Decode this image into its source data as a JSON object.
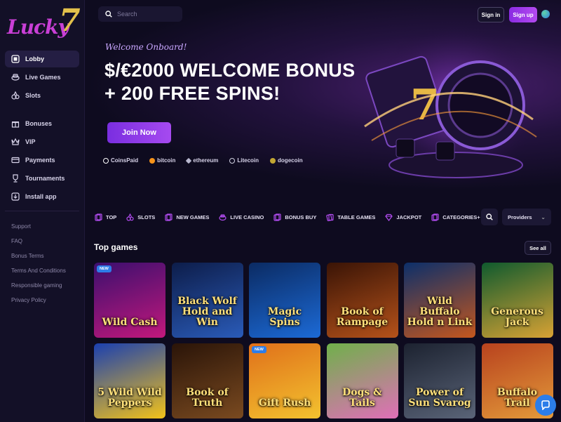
{
  "brand": {
    "logo_text": "Lucky",
    "logo_number": "7"
  },
  "sidebar": {
    "nav": [
      {
        "label": "Lobby",
        "icon": "lobby-icon",
        "active": true
      },
      {
        "label": "Live Games",
        "icon": "live-games-icon"
      },
      {
        "label": "Slots",
        "icon": "slots-icon"
      }
    ],
    "nav2": [
      {
        "label": "Bonuses",
        "icon": "gift-icon"
      },
      {
        "label": "VIP",
        "icon": "crown-icon"
      },
      {
        "label": "Payments",
        "icon": "card-icon"
      },
      {
        "label": "Tournaments",
        "icon": "trophy-icon"
      },
      {
        "label": "Install app",
        "icon": "download-icon"
      }
    ],
    "links": [
      "Support",
      "FAQ",
      "Bonus Terms",
      "Terms And Conditions",
      "Responsible gaming",
      "Privacy Policy"
    ]
  },
  "header": {
    "search_placeholder": "Search",
    "signin_label": "Sign in",
    "signup_label": "Sign up"
  },
  "hero": {
    "welcome": "Welcome Onboard!",
    "title_line1": "$/€2000 WELCOME BONUS",
    "title_line2": "+ 200 FREE SPINS!",
    "cta": "Join Now",
    "payments": [
      {
        "label": "CoinsPaid",
        "color": "#ffffff"
      },
      {
        "label": "bitcoin",
        "color": "#f7931a"
      },
      {
        "label": "ethereum",
        "color": "#b9b9d0"
      },
      {
        "label": "Litecoin",
        "color": "#d0d0e0"
      },
      {
        "label": "dogecoin",
        "color": "#c2a633"
      }
    ]
  },
  "categories": [
    {
      "label": "TOP"
    },
    {
      "label": "SLOTS"
    },
    {
      "label": "NEW GAMES"
    },
    {
      "label": "LIVE CASINO"
    },
    {
      "label": "BONUS BUY"
    },
    {
      "label": "TABLE GAMES"
    },
    {
      "label": "JACKPOT"
    },
    {
      "label": "CATEGORIES+"
    }
  ],
  "providers_label": "Providers",
  "games_section": {
    "title": "Top games",
    "see_all": "See all",
    "new_badge": "NEW",
    "games": [
      {
        "name": "Wild Cash",
        "colors": [
          "#3b0f6e",
          "#c2187c"
        ],
        "new": true
      },
      {
        "name": "Black Wolf Hold and Win",
        "colors": [
          "#0d1d4a",
          "#2a5bb8"
        ],
        "new": false
      },
      {
        "name": "Magic Spins",
        "colors": [
          "#0b2b63",
          "#1c6ad6"
        ],
        "new": false
      },
      {
        "name": "Book of Rampage",
        "colors": [
          "#3a1406",
          "#b5521a"
        ],
        "new": false
      },
      {
        "name": "Wild Buffalo Hold n Link",
        "colors": [
          "#0c2f6a",
          "#c4571e"
        ],
        "new": false
      },
      {
        "name": "Generous Jack",
        "colors": [
          "#0f5a2e",
          "#d8a234"
        ],
        "new": false
      },
      {
        "name": "5 Wild Wild Peppers",
        "colors": [
          "#1a3fb0",
          "#f2c21a"
        ],
        "new": false
      },
      {
        "name": "Book of Truth",
        "colors": [
          "#2a1408",
          "#7a4a20"
        ],
        "new": false
      },
      {
        "name": "Gift Rush",
        "colors": [
          "#e0701a",
          "#f3c22f"
        ],
        "new": true
      },
      {
        "name": "Dogs & Tails",
        "colors": [
          "#6fb04a",
          "#e06fb8"
        ],
        "new": false
      },
      {
        "name": "Power of Sun Svarog",
        "colors": [
          "#1c2230",
          "#5a6478"
        ],
        "new": false
      },
      {
        "name": "Buffalo Trail",
        "colors": [
          "#b8421e",
          "#e39a3a"
        ],
        "new": false
      }
    ]
  }
}
